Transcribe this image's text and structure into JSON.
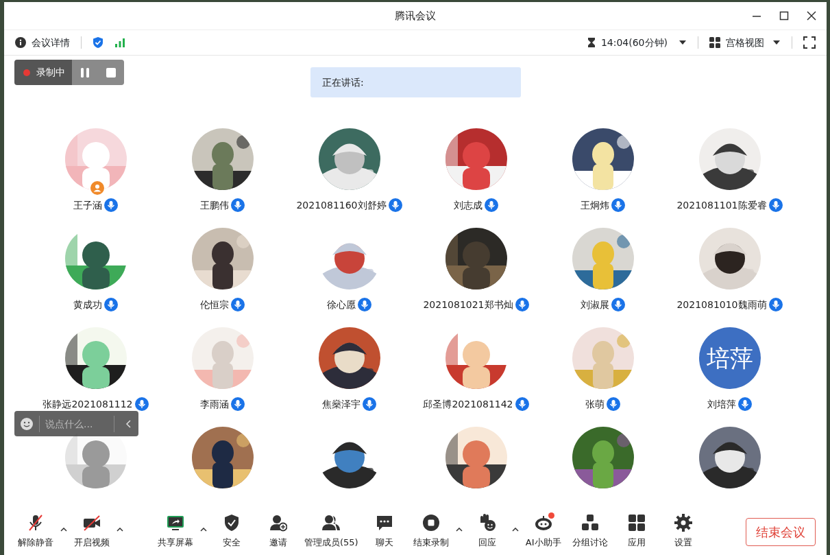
{
  "window": {
    "title": "腾讯会议"
  },
  "topbar": {
    "details": "会议详情",
    "time": "14:04(60分钟)",
    "view": "宫格视图"
  },
  "recording": {
    "label": "录制中"
  },
  "speaking": {
    "label": "正在讲话:"
  },
  "participants": [
    {
      "name": "王子涵",
      "host": true
    },
    {
      "name": "王鹏伟",
      "host": false
    },
    {
      "name": "2021081160刘舒婷",
      "host": false
    },
    {
      "name": "刘志成",
      "host": false
    },
    {
      "name": "王炯炜",
      "host": false
    },
    {
      "name": "2021081101陈爱睿",
      "host": false
    },
    {
      "name": "黄成功",
      "host": false
    },
    {
      "name": "伦恒宗",
      "host": false
    },
    {
      "name": "徐心愿",
      "host": false
    },
    {
      "name": "2021081021郑书灿",
      "host": false
    },
    {
      "name": "刘淑展",
      "host": false
    },
    {
      "name": "2021081010魏雨萌",
      "host": false
    },
    {
      "name": "张静远2021081112",
      "host": false
    },
    {
      "name": "李雨涵",
      "host": false
    },
    {
      "name": "焦燊泽宇",
      "host": false
    },
    {
      "name": "邱圣博2021081142",
      "host": false
    },
    {
      "name": "张萌",
      "host": false
    },
    {
      "name": "刘培萍",
      "host": false,
      "avatar": {
        "kind": "text",
        "text": "培萍",
        "color": "#3d6fc2"
      }
    },
    {
      "host": false
    },
    {
      "host": false
    },
    {
      "host": false
    },
    {
      "host": false
    },
    {
      "host": false
    },
    {
      "host": false
    }
  ],
  "chat_input": {
    "placeholder": "说点什么..."
  },
  "toolbar": [
    {
      "kind": "mic",
      "label": "解除静音",
      "off": true,
      "caret": true
    },
    {
      "kind": "video",
      "label": "开启视频",
      "off": true,
      "caret": true
    },
    {
      "kind": "share",
      "label": "共享屏幕",
      "caret": true,
      "gap_before": true
    },
    {
      "kind": "security",
      "label": "安全"
    },
    {
      "kind": "invite",
      "label": "邀请"
    },
    {
      "kind": "members",
      "label": "管理成员(55)"
    },
    {
      "kind": "chat",
      "label": "聊天"
    },
    {
      "kind": "record",
      "label": "结束录制",
      "caret": true
    },
    {
      "kind": "react",
      "label": "回应",
      "caret": true
    },
    {
      "kind": "ai",
      "label": "AI小助手",
      "notification": true
    },
    {
      "kind": "breakout",
      "label": "分组讨论"
    },
    {
      "kind": "apps",
      "label": "应用"
    },
    {
      "kind": "settings",
      "label": "设置"
    }
  ],
  "end_button": {
    "label": "结束会议"
  }
}
